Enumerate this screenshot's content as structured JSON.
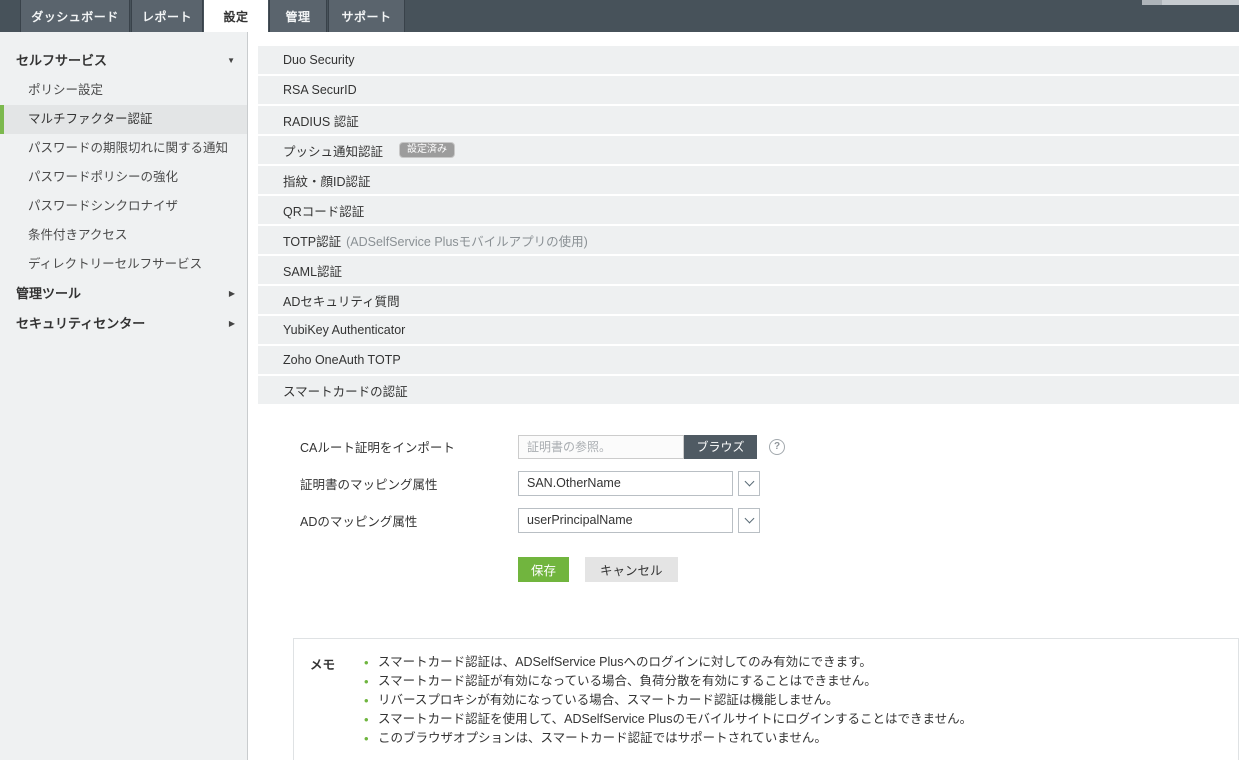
{
  "topnav": {
    "tabs": [
      {
        "label": "ダッシュボード",
        "active": false
      },
      {
        "label": "レポート",
        "active": false
      },
      {
        "label": "設定",
        "active": true
      },
      {
        "label": "管理",
        "active": false
      },
      {
        "label": "サポート",
        "active": false
      }
    ]
  },
  "sidebar": {
    "section_self_service": {
      "label": "セルフサービス",
      "arrow": "▼"
    },
    "items": [
      {
        "label": "ポリシー設定"
      },
      {
        "label": "マルチファクター認証",
        "selected": true
      },
      {
        "label": "パスワードの期限切れに関する通知"
      },
      {
        "label": "パスワードポリシーの強化"
      },
      {
        "label": "パスワードシンクロナイザ"
      },
      {
        "label": "条件付きアクセス"
      },
      {
        "label": "ディレクトリーセルフサービス"
      }
    ],
    "section_admin_tools": {
      "label": "管理ツール",
      "arrow": "▶"
    },
    "section_security_center": {
      "label": "セキュリティセンター",
      "arrow": "▶"
    }
  },
  "accordion": {
    "items": [
      {
        "label": "Duo Security"
      },
      {
        "label": "RSA SecurID"
      },
      {
        "label": "RADIUS 認証"
      },
      {
        "label": "プッシュ通知認証",
        "badge": "設定済み"
      },
      {
        "label": "指紋・顔ID認証"
      },
      {
        "label": "QRコード認証"
      },
      {
        "label": "TOTP認証",
        "suffix": "(ADSelfService Plusモバイルアプリの使用)"
      },
      {
        "label": "SAML認証"
      },
      {
        "label": "ADセキュリティ質問"
      },
      {
        "label": "YubiKey Authenticator"
      },
      {
        "label": "Zoho OneAuth TOTP"
      },
      {
        "label": "スマートカードの認証",
        "expanded": true
      }
    ]
  },
  "form": {
    "import_row": {
      "label": "CAルート証明をインポート",
      "placeholder": "証明書の参照。",
      "browse_label": "ブラウズ",
      "help": "?"
    },
    "cert_attr_row": {
      "label": "証明書のマッピング属性",
      "value": "SAN.OtherName"
    },
    "ad_attr_row": {
      "label": "ADのマッピング属性",
      "value": "userPrincipalName"
    },
    "save_label": "保存",
    "cancel_label": "キャンセル"
  },
  "note": {
    "title": "メモ",
    "items": [
      "スマートカード認証は、ADSelfService Plusへのログインに対してのみ有効にできます。",
      "スマートカード認証が有効になっている場合、負荷分散を有効にすることはできません。",
      "リバースプロキシが有効になっている場合、スマートカード認証は機能しません。",
      "スマートカード認証を使用して、ADSelfService Plusのモバイルサイトにログインすることはできません。",
      "このブラウザオプションは、スマートカード認証ではサポートされていません。"
    ]
  },
  "colors": {
    "accent_green": "#71b53e",
    "tab_bar": "#47525a",
    "selected_border": "#7cb94e"
  }
}
